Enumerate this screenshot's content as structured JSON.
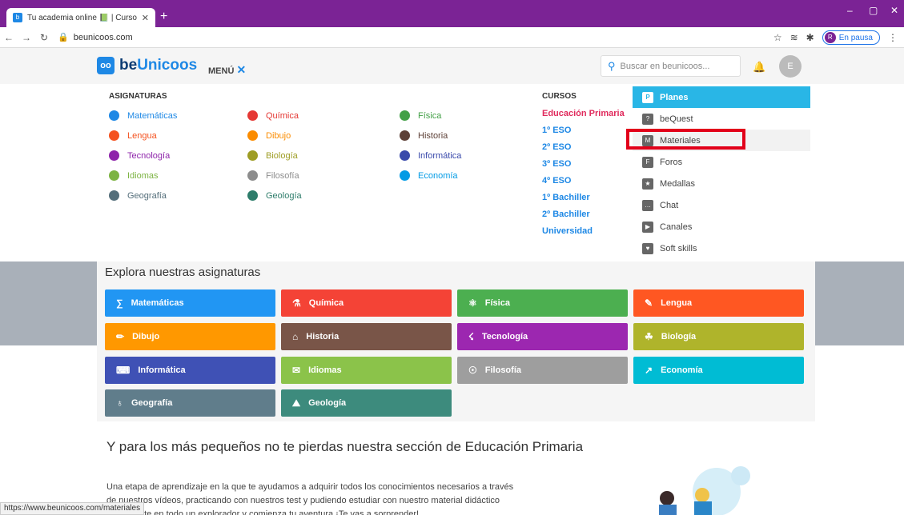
{
  "browser": {
    "tab_title": "Tu academia online 📗 | Cursos",
    "new_tab": "+",
    "url": "beunicoos.com",
    "pause_label": "En pausa",
    "pause_initial": "R",
    "status_url": "https://www.beunicoos.com/materiales"
  },
  "header": {
    "logo_badge": "oo",
    "logo_be": "be",
    "logo_rest": "Unicoos",
    "menu_label": "MENÚ",
    "search_placeholder": "Buscar en beunicoos...",
    "avatar": "E"
  },
  "menu": {
    "asignaturas_title": "ASIGNATURAS",
    "col1": [
      {
        "label": "Matemáticas",
        "color": "#1e88e5"
      },
      {
        "label": "Lengua",
        "color": "#f4511e"
      },
      {
        "label": "Tecnología",
        "color": "#8e24aa"
      },
      {
        "label": "Idiomas",
        "color": "#7cb342"
      },
      {
        "label": "Geografía",
        "color": "#546e7a"
      }
    ],
    "col2": [
      {
        "label": "Química",
        "color": "#e53935"
      },
      {
        "label": "Dibujo",
        "color": "#fb8c00"
      },
      {
        "label": "Biología",
        "color": "#9e9d24"
      },
      {
        "label": "Filosofía",
        "color": "#8d8d8d"
      },
      {
        "label": "Geología",
        "color": "#2e7d6b"
      }
    ],
    "col3": [
      {
        "label": "Física",
        "color": "#43a047"
      },
      {
        "label": "Historia",
        "color": "#5d4037"
      },
      {
        "label": "Informática",
        "color": "#3949ab"
      },
      {
        "label": "Economía",
        "color": "#039be5"
      }
    ],
    "cursos_title": "CURSOS",
    "cursos": [
      "Educación Primaria",
      "1º ESO",
      "2º ESO",
      "3º ESO",
      "4º ESO",
      "1º Bachiller",
      "2º Bachiller",
      "Universidad"
    ],
    "side": [
      {
        "label": "Planes",
        "icon": "P"
      },
      {
        "label": "beQuest",
        "icon": "?"
      },
      {
        "label": "Materiales",
        "icon": "M"
      },
      {
        "label": "Foros",
        "icon": "F"
      },
      {
        "label": "Medallas",
        "icon": "★"
      },
      {
        "label": "Chat",
        "icon": "…"
      },
      {
        "label": "Canales",
        "icon": "▶"
      },
      {
        "label": "Soft skills",
        "icon": "♥"
      }
    ]
  },
  "explore": {
    "title": "Explora nuestras asignaturas",
    "subjects": [
      {
        "label": "Matemáticas",
        "color": "#2196f3",
        "icon": "∑"
      },
      {
        "label": "Química",
        "color": "#f44336",
        "icon": "⚗"
      },
      {
        "label": "Física",
        "color": "#4caf50",
        "icon": "⚛"
      },
      {
        "label": "Lengua",
        "color": "#ff5722",
        "icon": "✎"
      },
      {
        "label": "Dibujo",
        "color": "#ff9800",
        "icon": "✏"
      },
      {
        "label": "Historia",
        "color": "#795548",
        "icon": "⌂"
      },
      {
        "label": "Tecnología",
        "color": "#9c27b0",
        "icon": "☇"
      },
      {
        "label": "Biología",
        "color": "#afb42b",
        "icon": "☘"
      },
      {
        "label": "Informática",
        "color": "#3f51b5",
        "icon": "⌨"
      },
      {
        "label": "Idiomas",
        "color": "#8bc34a",
        "icon": "✉"
      },
      {
        "label": "Filosofía",
        "color": "#9e9e9e",
        "icon": "☉"
      },
      {
        "label": "Economía",
        "color": "#00bcd4",
        "icon": "↗"
      },
      {
        "label": "Geografía",
        "color": "#607d8b",
        "icon": "♁"
      },
      {
        "label": "Geología",
        "color": "#3d8b7d",
        "icon": "⛰"
      }
    ]
  },
  "primaria": {
    "title": "Y para los más pequeños no te pierdas nuestra sección de Educación Primaria",
    "line1": "Una etapa de aprendizaje en la que te ayudamos a adquirir todos los conocimientos necesarios a través",
    "line2": "de nuestros vídeos, practicando con nuestros test y pudiendo estudiar con nuestro material didáctico",
    "line3": "Conviértete en todo un explorador y comienza tu aventura ¡Te vas a sorprender!"
  }
}
